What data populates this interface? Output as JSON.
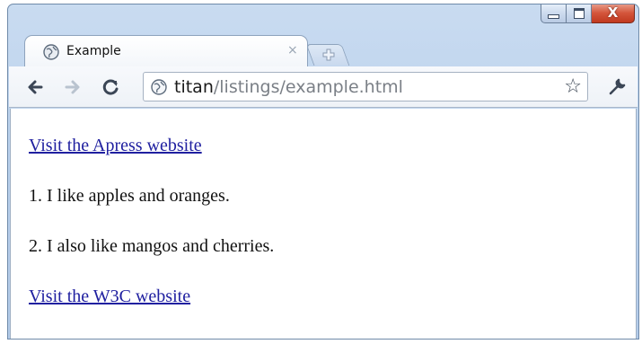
{
  "window": {
    "controls": {
      "minimize_icon": "minimize-icon",
      "maximize_icon": "maximize-icon",
      "close_glyph": "X",
      "close_color": "#c73c22"
    }
  },
  "tabs": [
    {
      "title": "Example",
      "close_glyph": "×",
      "icon": "globe-icon",
      "active": true
    }
  ],
  "new_tab_icon": "new-tab-icon",
  "toolbar": {
    "back_icon": "back-arrow-icon",
    "forward_icon": "forward-arrow-icon",
    "reload_icon": "reload-icon",
    "omnibox": {
      "host": "titan",
      "path": "/listings/example.html",
      "site_icon": "globe-icon",
      "bookmark_glyph": "☆"
    },
    "wrench_icon": "wrench-icon"
  },
  "content": {
    "link1": "Visit the Apress website",
    "para1": "1. I like apples and oranges.",
    "para2": "2. I also like mangos and cherries.",
    "link2": "Visit the W3C website",
    "link_color": "#2020a0"
  }
}
